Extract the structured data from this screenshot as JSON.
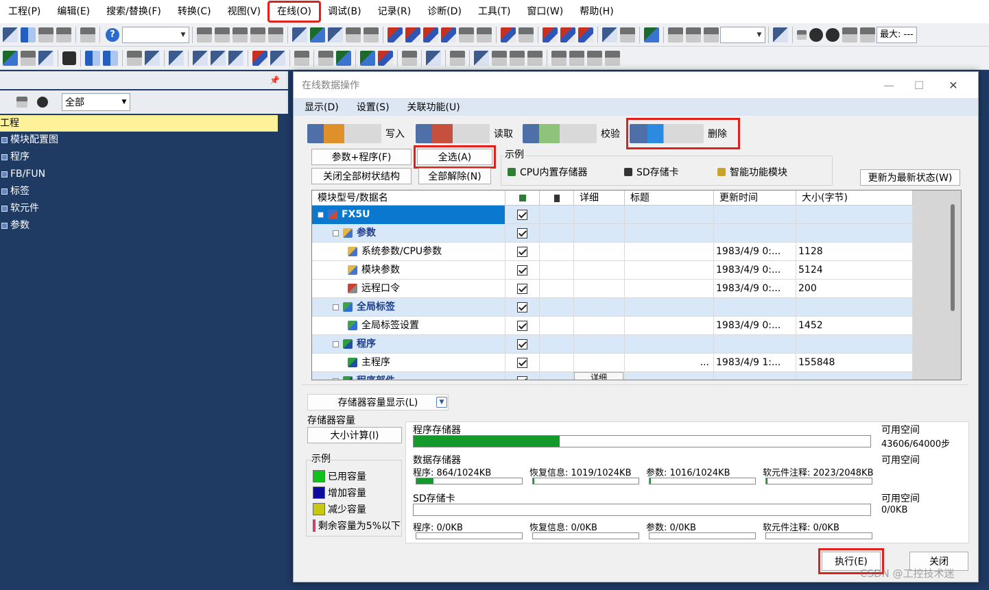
{
  "menubar": {
    "items": [
      "工程(P)",
      "编辑(E)",
      "搜索/替换(F)",
      "转换(C)",
      "视图(V)",
      "在线(O)",
      "调试(B)",
      "记录(R)",
      "诊断(D)",
      "工具(T)",
      "窗口(W)",
      "帮助(H)"
    ],
    "highlighted_index": 5
  },
  "toolbar": {
    "max_label": "最大: ---"
  },
  "left_panel": {
    "filter_value": "全部",
    "tree": [
      {
        "label": "工程",
        "root": true
      },
      {
        "label": "模块配置图"
      },
      {
        "label": "程序"
      },
      {
        "label": "FB/FUN"
      },
      {
        "label": "标签"
      },
      {
        "label": "软元件"
      },
      {
        "label": "参数"
      }
    ]
  },
  "dialog": {
    "title": "在线数据操作",
    "menu": [
      "显示(D)",
      "设置(S)",
      "关联功能(U)"
    ],
    "tabs": {
      "write": "写入",
      "read": "读取",
      "verify": "校验",
      "delete": "删除"
    },
    "buttons": {
      "param_program": "参数+程序(F)",
      "select_all": "全选(A)",
      "close_tree": "关闭全部树状结构",
      "deselect_all": "全部解除(N)",
      "update_latest": "更新为最新状态(W)",
      "execute": "执行(E)",
      "close": "关闭",
      "size_calc": "大小计算(I)"
    },
    "legend": {
      "title": "示例",
      "items": [
        "CPU内置存储器",
        "SD存储卡",
        "智能功能模块"
      ]
    },
    "table": {
      "columns": [
        "模块型号/数据名",
        "",
        "",
        "详细",
        "标题",
        "更新时间",
        "大小(字节)"
      ],
      "rows": [
        {
          "name": "FX5U",
          "level": 0,
          "group": true,
          "selected": true,
          "checked": true,
          "detail": "",
          "title": "",
          "time": "",
          "size": ""
        },
        {
          "name": "参数",
          "level": 1,
          "group": true,
          "checked": true,
          "detail": "",
          "title": "",
          "time": "",
          "size": ""
        },
        {
          "name": "系统参数/CPU参数",
          "level": 2,
          "checked": true,
          "detail": "",
          "title": "",
          "time": "1983/4/9 0:...",
          "size": "1128"
        },
        {
          "name": "模块参数",
          "level": 2,
          "checked": true,
          "detail": "",
          "title": "",
          "time": "1983/4/9 0:...",
          "size": "5124"
        },
        {
          "name": "远程口令",
          "level": 2,
          "checked": true,
          "detail": "",
          "title": "",
          "time": "1983/4/9 0:...",
          "size": "200"
        },
        {
          "name": "全局标签",
          "level": 1,
          "group": true,
          "checked": true,
          "detail": "",
          "title": "",
          "time": "",
          "size": ""
        },
        {
          "name": "全局标签设置",
          "level": 2,
          "checked": true,
          "detail": "",
          "title": "",
          "time": "1983/4/9 0:...",
          "size": "1452"
        },
        {
          "name": "程序",
          "level": 1,
          "group": true,
          "checked": true,
          "detail": "",
          "title": "",
          "time": "",
          "size": ""
        },
        {
          "name": "主程序",
          "level": 2,
          "checked": true,
          "detail": "",
          "title": "...",
          "time": "1983/4/9 1:...",
          "size": "155848"
        },
        {
          "name": "程序部件",
          "level": 1,
          "group": true,
          "checked": true,
          "detail": "详细",
          "title": "",
          "time": "",
          "size": ""
        }
      ]
    },
    "capacity": {
      "toggle_label": "存储器容量显示(L)",
      "section_label": "存储器容量",
      "program_memory_label": "程序存储器",
      "program_memory_fill": 0.32,
      "free_label": "可用空间",
      "program_memory_free": "43606/64000步",
      "data_memory_label": "数据存储器",
      "data_memory_free_label": "可用空间",
      "data_subs": [
        {
          "label": "程序: 864/1024KB",
          "fill": 0.16
        },
        {
          "label": "恢复信息: 1019/1024KB",
          "fill": 0.005
        },
        {
          "label": "参数: 1016/1024KB",
          "fill": 0.008
        },
        {
          "label": "软元件注释: 2023/2048KB",
          "fill": 0.012
        }
      ],
      "sd_label": "SD存储卡",
      "sd_free_label": "可用空间",
      "sd_free": "0/0KB",
      "sd_subs": [
        {
          "label": "程序: 0/0KB"
        },
        {
          "label": "恢复信息: 0/0KB"
        },
        {
          "label": "参数: 0/0KB"
        },
        {
          "label": "软元件注释: 0/0KB"
        }
      ]
    },
    "examples": {
      "title": "示例",
      "items": [
        {
          "label": "已用容量",
          "color": "#12c21a"
        },
        {
          "label": "增加容量",
          "color": "#0b0ba0"
        },
        {
          "label": "减少容量",
          "color": "#c8c812"
        },
        {
          "label": "剩余容量为5%以下",
          "color": "#ff2d78"
        }
      ]
    }
  },
  "watermark": "CSDN @工控技术迷"
}
